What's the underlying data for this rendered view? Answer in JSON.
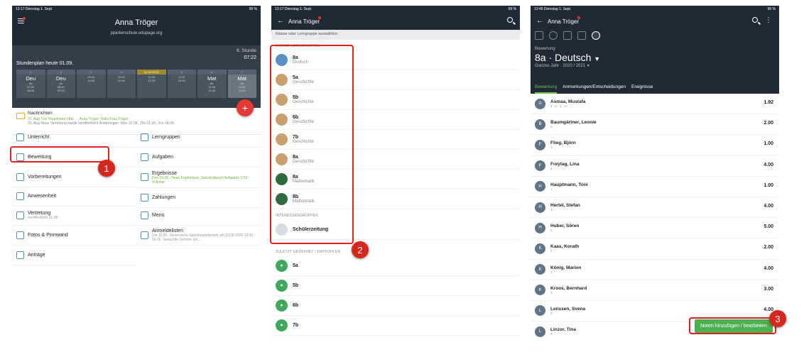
{
  "panel1": {
    "status_time": "13:17",
    "status_date": "Dienstag 1. Sept.",
    "status_battery": "99 %",
    "title": "Anna Tröger",
    "subtitle": "pparkerschule.edupage.org",
    "stunde": "6. Stunde",
    "time": "07:22",
    "heute": "Stundenplan heute 01.09.",
    "periods": [
      {
        "num": "1",
        "subject": "Deu",
        "cls": "8a",
        "t1": "07:50",
        "t2": "08:35"
      },
      {
        "num": "2",
        "subject": "Deu",
        "cls": "8a",
        "t1": "08:40",
        "t2": "09:25"
      },
      {
        "num": "3",
        "subject": "",
        "cls": "",
        "t1": "09:45",
        "t2": "10:25"
      },
      {
        "num": "4",
        "subject": "",
        "cls": "",
        "t1": "10:30",
        "t2": "11:15"
      },
      {
        "num": "11:15-11:25",
        "subject": "",
        "cls": "",
        "t1": "11:15",
        "t2": "11:25"
      },
      {
        "num": "5",
        "subject": "",
        "cls": "",
        "t1": "11:30",
        "t2": "12:15"
      },
      {
        "num": "6",
        "subject": "Mat",
        "cls": "8b",
        "t1": "11:45",
        "t2": "12:30"
      },
      {
        "num": "7",
        "subject": "Mat",
        "cls": "8b",
        "t1": "12:40",
        "t2": "13:25"
      }
    ],
    "msg_title": "Nachrichten",
    "msg_line1": "31. Aug   Toni Hauptmann (8a) → Anna Tröger: Hallo Frau Tröger",
    "msg_line2": "31. Aug   Neue Vertretung wurde veröffentlicht Änderungen: Mon 31.08., Die 01.09., Fre 04.09.",
    "menu_left": [
      {
        "label": "Unterricht",
        "sub": ""
      },
      {
        "label": "Bewertung",
        "sub": ""
      },
      {
        "label": "Vorbereitungen",
        "sub": ""
      },
      {
        "label": "Anwesenheit",
        "sub": ""
      },
      {
        "label": "Vertretung",
        "sub": "veröffentlicht 31.08."
      },
      {
        "label": "Fotos & Pinnwand",
        "sub": ""
      },
      {
        "label": "Anträge",
        "sub": ""
      }
    ],
    "menu_right": [
      {
        "label": "Lerngruppen",
        "sub": ""
      },
      {
        "label": "Aufgaben",
        "sub": ""
      },
      {
        "label": "Ergebnisse",
        "sub": "Don 06.08.: Neue Ergebnisse: Satzstrukturen Aufgaben 1/15 – Volkmer"
      },
      {
        "label": "Zahlungen",
        "sub": ""
      },
      {
        "label": "Menü",
        "sub": ""
      },
      {
        "label": "Anmeldelisten",
        "sub": "Die 11.08.: Reservierte Sprechstundenzeit am 19.08.2020 14:00 - 16:00. Gebuchte Termine am..."
      }
    ]
  },
  "panel2": {
    "status_time": "13:17",
    "status_date": "Dienstag 1. Sept.",
    "status_battery": "99 %",
    "title": "Anna Tröger",
    "hint": "Klasse oder Lerngruppe auswählen:",
    "section_own": "EIGENE LERNGRUPPEN",
    "own_groups": [
      {
        "name": "8a",
        "subject": "Deutsch",
        "color": "#5a8fc4"
      },
      {
        "name": "5a",
        "subject": "Geschichte",
        "color": "#c9a070"
      },
      {
        "name": "5b",
        "subject": "Geschichte",
        "color": "#c9a070"
      },
      {
        "name": "6b",
        "subject": "Geschichte",
        "color": "#c9a070"
      },
      {
        "name": "7b",
        "subject": "Geschichte",
        "color": "#c9a070"
      },
      {
        "name": "8a",
        "subject": "Geschichte",
        "color": "#c9a070"
      },
      {
        "name": "8a",
        "subject": "Mathematik",
        "color": "#2e6b3e"
      },
      {
        "name": "8b",
        "subject": "Mathematik",
        "color": "#2e6b3e"
      }
    ],
    "section_interest": "INTERESSENGRUPPEN",
    "interest_groups": [
      {
        "name": "Schülerzeitung"
      }
    ],
    "section_recent": "ZULETZT GEÖFFNET / EMPFOHLEN",
    "recent": [
      "5a",
      "5b",
      "6b",
      "7b"
    ]
  },
  "panel3": {
    "status_time": "13:45",
    "status_date": "Dienstag 1. Sept.",
    "status_battery": "96 %",
    "title": "Anna Tröger",
    "label": "Bewertung",
    "course": "8a · Deutsch",
    "year": "Ganzes Jahr · 2020 / 2021",
    "tabs": [
      "Bewertung",
      "Anmerkungen/Entscheidungen",
      "Ereignisse"
    ],
    "students": [
      {
        "initial": "A",
        "name": "Asmaa, Mustafa",
        "grades": "3 · 1 · 1 · 2+",
        "avg": "1.92"
      },
      {
        "initial": "B",
        "name": "Baumgärtner, Leonie",
        "grades": "2",
        "avg": "2.00"
      },
      {
        "initial": "F",
        "name": "Flieg, Björn",
        "grades": "1",
        "avg": "1.00"
      },
      {
        "initial": "F",
        "name": "Freytag, Lina",
        "grades": "4",
        "avg": "4.00"
      },
      {
        "initial": "H",
        "name": "Hauptmann, Toni",
        "grades": "1",
        "avg": "1.00"
      },
      {
        "initial": "H",
        "name": "Hertel, Stefan",
        "grades": "4",
        "avg": "4.00"
      },
      {
        "initial": "H",
        "name": "Huber, Sören",
        "grades": "5",
        "avg": "5.00"
      },
      {
        "initial": "K",
        "name": "Kaas, Korath",
        "grades": "2",
        "avg": "2.00"
      },
      {
        "initial": "K",
        "name": "König, Marion",
        "grades": "4",
        "avg": "4.00"
      },
      {
        "initial": "K",
        "name": "Kroos, Bernhard",
        "grades": "3",
        "avg": "3.00"
      },
      {
        "initial": "L",
        "name": "Lenssen, Svena",
        "grades": "4",
        "avg": "4.00"
      },
      {
        "initial": "L",
        "name": "Linzor, Tina",
        "grades": "3",
        "avg": ""
      }
    ],
    "add_button": "Noten hinzufügen / bearbeiten"
  },
  "badges": [
    "1",
    "2",
    "3"
  ],
  "colors": {
    "header": "#1f2a36",
    "accent": "#e53935",
    "green": "#4caf50"
  }
}
